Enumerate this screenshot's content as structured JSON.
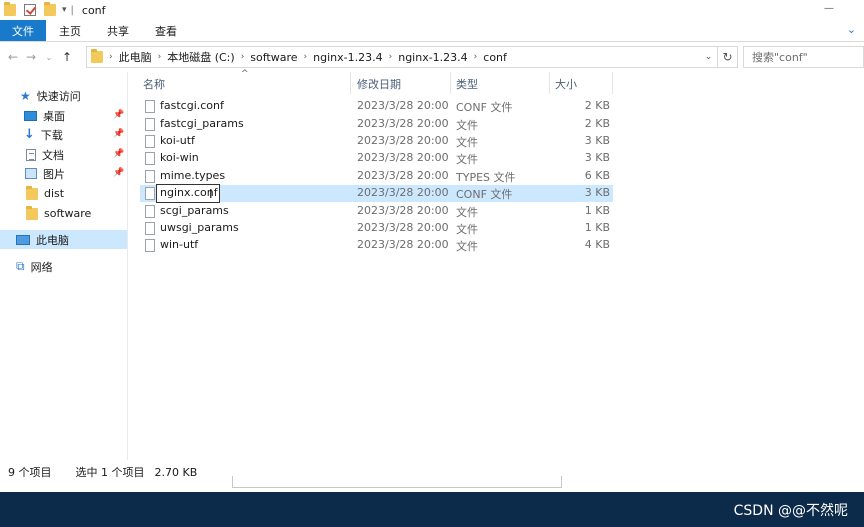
{
  "window": {
    "title": "conf"
  },
  "ribbon": {
    "tabs": [
      "文件",
      "主页",
      "共享",
      "查看"
    ]
  },
  "address": {
    "crumbs": [
      "此电脑",
      "本地磁盘 (C:)",
      "software",
      "nginx-1.23.4",
      "nginx-1.23.4",
      "conf"
    ],
    "search_placeholder": "搜索\"conf\""
  },
  "navpane": {
    "quick_access": "快速访问",
    "items": [
      "桌面",
      "下载",
      "文档",
      "图片",
      "dist",
      "software"
    ],
    "this_pc": "此电脑",
    "network": "网络"
  },
  "columns": {
    "name": "名称",
    "date": "修改日期",
    "type": "类型",
    "size": "大小"
  },
  "files": [
    {
      "name": "fastcgi.conf",
      "date": "2023/3/28 20:00",
      "type": "CONF 文件",
      "size": "2 KB"
    },
    {
      "name": "fastcgi_params",
      "date": "2023/3/28 20:00",
      "type": "文件",
      "size": "2 KB"
    },
    {
      "name": "koi-utf",
      "date": "2023/3/28 20:00",
      "type": "文件",
      "size": "3 KB"
    },
    {
      "name": "koi-win",
      "date": "2023/3/28 20:00",
      "type": "文件",
      "size": "3 KB"
    },
    {
      "name": "mime.types",
      "date": "2023/3/28 20:00",
      "type": "TYPES 文件",
      "size": "6 KB"
    },
    {
      "name": "nginx.conf",
      "date": "2023/3/28 20:00",
      "type": "CONF 文件",
      "size": "3 KB"
    },
    {
      "name": "scgi_params",
      "date": "2023/3/28 20:00",
      "type": "文件",
      "size": "1 KB"
    },
    {
      "name": "uwsgi_params",
      "date": "2023/3/28 20:00",
      "type": "文件",
      "size": "1 KB"
    },
    {
      "name": "win-utf",
      "date": "2023/3/28 20:00",
      "type": "文件",
      "size": "4 KB"
    }
  ],
  "status": {
    "count": "9 个项目",
    "selected": "选中 1 个项目",
    "selected_size": "2.70 KB"
  },
  "watermark": {
    "corner": "CSDN @@不然呢"
  }
}
